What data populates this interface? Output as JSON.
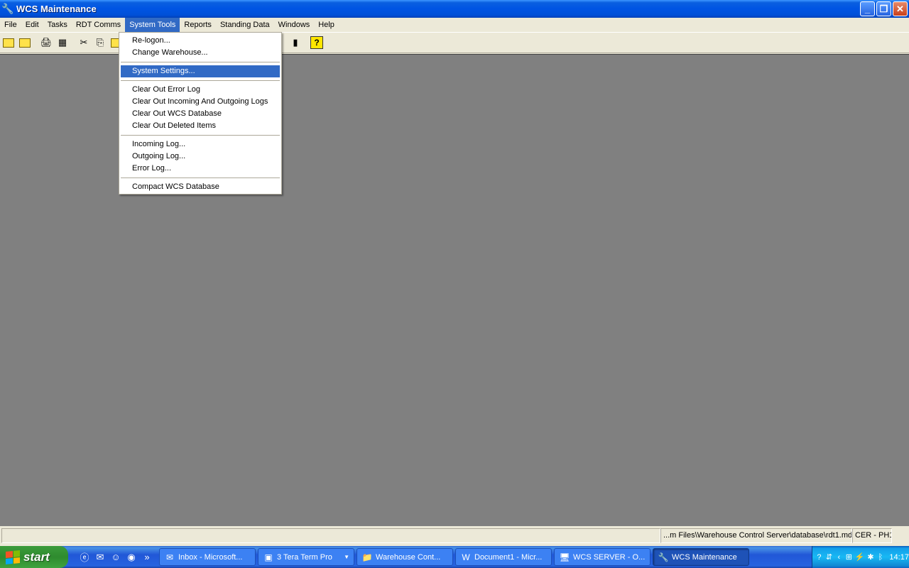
{
  "window": {
    "title": "WCS Maintenance"
  },
  "menubar": {
    "items": [
      "File",
      "Edit",
      "Tasks",
      "RDT Comms",
      "System Tools",
      "Reports",
      "Standing Data",
      "Windows",
      "Help"
    ],
    "active": "System Tools"
  },
  "dropdown": {
    "groups": [
      [
        "Re-logon...",
        "Change Warehouse..."
      ],
      [
        "System Settings..."
      ],
      [
        "Clear Out Error Log",
        "Clear Out Incoming And Outgoing Logs",
        "Clear Out WCS Database",
        "Clear Out Deleted Items"
      ],
      [
        "Incoming Log...",
        "Outgoing Log...",
        "Error Log..."
      ],
      [
        "Compact WCS Database"
      ]
    ],
    "highlighted": "System Settings..."
  },
  "statusbar": {
    "path": "...m Files\\Warehouse Control Server\\database\\rdt1.mdb",
    "site": "CER - PH1"
  },
  "taskbar": {
    "start_label": "start",
    "buttons": [
      {
        "label": "Inbox - Microsoft...",
        "icon": "outlook-icon"
      },
      {
        "label": "3 Tera Term Pro",
        "icon": "terminal-icon"
      },
      {
        "label": "Warehouse Cont...",
        "icon": "folder-icon"
      },
      {
        "label": "Document1 - Micr...",
        "icon": "word-icon"
      },
      {
        "label": "WCS SERVER - O...",
        "icon": "computer-icon"
      },
      {
        "label": "WCS Maintenance",
        "icon": "wrench-icon",
        "active": true
      }
    ],
    "clock": "14:17"
  },
  "colors": {
    "highlight": "#316ac5",
    "workspace": "#808080",
    "titlebar": "#0054e3"
  }
}
